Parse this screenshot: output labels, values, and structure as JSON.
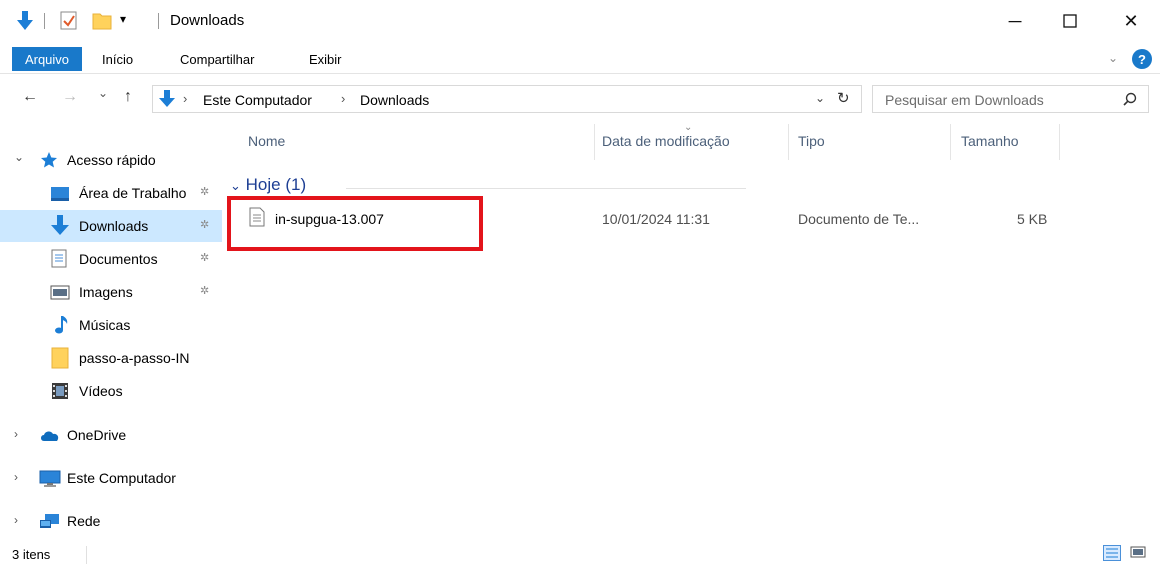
{
  "window": {
    "title": "Downloads",
    "minimize_glyph": "─",
    "maximize_glyph": "☐",
    "close_glyph": "✕"
  },
  "quick_access_toolbar": {
    "icons": [
      "download-arrow-icon",
      "properties-check-icon",
      "new-folder-icon"
    ],
    "dropdown_glyph": "▾"
  },
  "ribbon": {
    "file_tab": "Arquivo",
    "tabs": [
      "Início",
      "Compartilhar",
      "Exibir"
    ],
    "help_glyph": "?"
  },
  "navigation": {
    "back_glyph": "←",
    "forward_glyph": "→",
    "recent_glyph": "⌄",
    "up_glyph": "↑",
    "breadcrumb": [
      "Este Computador",
      "Downloads"
    ],
    "breadcrumb_sep": "›",
    "dropdown_glyph": "⌄",
    "refresh_glyph": "↻"
  },
  "search": {
    "placeholder": "Pesquisar em Downloads"
  },
  "sidebar": {
    "items": [
      {
        "label": "Acesso rápido",
        "icon": "star-icon",
        "chevron": "⌄"
      },
      {
        "label": "Área de Trabalho",
        "icon": "desktop-icon",
        "pinned": true
      },
      {
        "label": "Downloads",
        "icon": "download-icon",
        "pinned": true,
        "selected": true
      },
      {
        "label": "Documentos",
        "icon": "documents-icon",
        "pinned": true
      },
      {
        "label": "Imagens",
        "icon": "pictures-icon",
        "pinned": true
      },
      {
        "label": "Músicas",
        "icon": "music-icon"
      },
      {
        "label": "passo-a-passo-IN",
        "icon": "folder-icon"
      },
      {
        "label": "Vídeos",
        "icon": "videos-icon"
      },
      {
        "label": "OneDrive",
        "icon": "cloud-icon",
        "chevron": "›"
      },
      {
        "label": "Este Computador",
        "icon": "computer-icon",
        "chevron": "›"
      },
      {
        "label": "Rede",
        "icon": "network-icon",
        "chevron": "›"
      }
    ],
    "pin_glyph": "📌"
  },
  "content": {
    "columns": [
      "Nome",
      "Data de modificação",
      "Tipo",
      "Tamanho"
    ],
    "group": {
      "label": "Hoje (1)",
      "chevron": "⌄"
    },
    "rows": [
      {
        "name": "in-supgua-13.007",
        "modified": "10/01/2024 11:31",
        "type": "Documento de Te...",
        "size": "5 KB"
      }
    ],
    "highlight_color": "#e3141b"
  },
  "status_bar": {
    "count": "3 itens"
  },
  "colors": {
    "accent": "#1979ca",
    "selection": "#cce8ff",
    "column_header": "#4c607a",
    "group_header": "#1e3f94"
  }
}
